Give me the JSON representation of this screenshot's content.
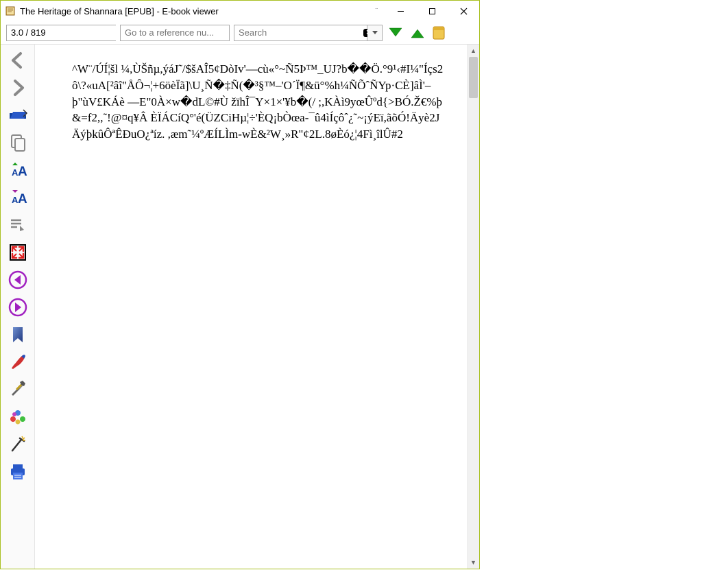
{
  "window": {
    "title": "The Heritage of Shannara [EPUB] - E-book viewer"
  },
  "toolbar": {
    "page_value": "3.0 / 819",
    "ref_placeholder": "Go to a reference nu...",
    "search_placeholder": "Search"
  },
  "content": {
    "body": "^W¨/ÚÍ¦šl ¼,ÙŠñµ,ýáJ˜/$šAÎ5¢DòIv'—cù«°~Ñ5Þ™_UJ?b��Ö.°9¹‹#I¼\"Íçs2ô\\?«uA[²âî\"ÅÔ¬¦+6öèÏã]\\U¸Ñ�‡Ñ(�³§™–'O´Ï¶&ü°%h¼ÑÕˆÑYp·CÈ]âÌ'–þ\"ùV£KÁè —E\"0À×w�dL©#Ù žïhÎ¯Y×1×'¥b�(/ ;,KÀì9yœÛºd{>BÓ.Ž€%þ&=f2,,˜!@¤q¥Â ÈÏÁCíQ°'é(ÜZCiHµ¦÷'ÈQ¡bÒœa-¯û4ìÍçôˆ¿˜~¡ýEï,ãõÓ!Äyè2JÄýþkûÔªÊÐuO¿ªíz. ,æm˜¼ºÆÍLÌm-wÈ&²W¸»R\"¢2L.8øÈó¿¦4Fì¸îlÛ#2"
  }
}
